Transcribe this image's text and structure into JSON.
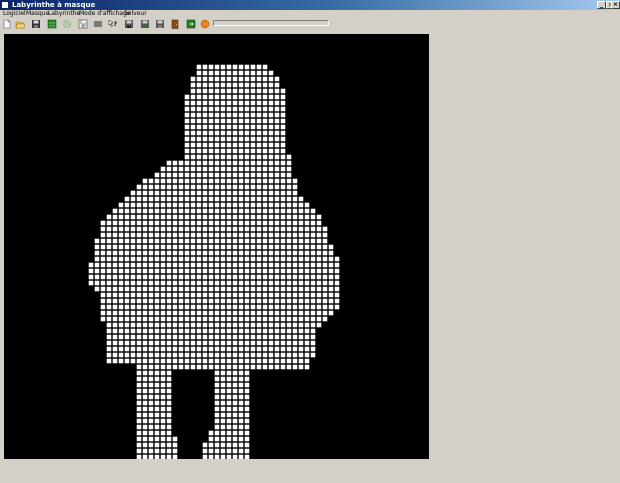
{
  "window": {
    "title": "Labyrinthe à masque"
  },
  "menu": [
    {
      "label": "Logiciel"
    },
    {
      "label": "Masque"
    },
    {
      "label": "Labyrinthe"
    },
    {
      "label": "Mode d'affichage"
    },
    {
      "label": "Solveur"
    }
  ],
  "toolbar": {
    "icons": [
      "new-file-icon",
      "open-folder-icon",
      "save-icon",
      "green-grid-icon",
      "gear-icon",
      "maze-icon",
      "lines-icon",
      "pointer-help-icon",
      "floppy-icon",
      "floppy-2-icon",
      "floppy-3-icon",
      "door-icon",
      "exit-icon",
      "solver-run-icon"
    ],
    "progress": 0.0
  },
  "colors": {
    "titlebar_start": "#0a246a",
    "canvas_bg": "#000000",
    "cell_fill": "#ffffff",
    "cell_line": "#000000",
    "chrome": "#d4d0c8"
  }
}
